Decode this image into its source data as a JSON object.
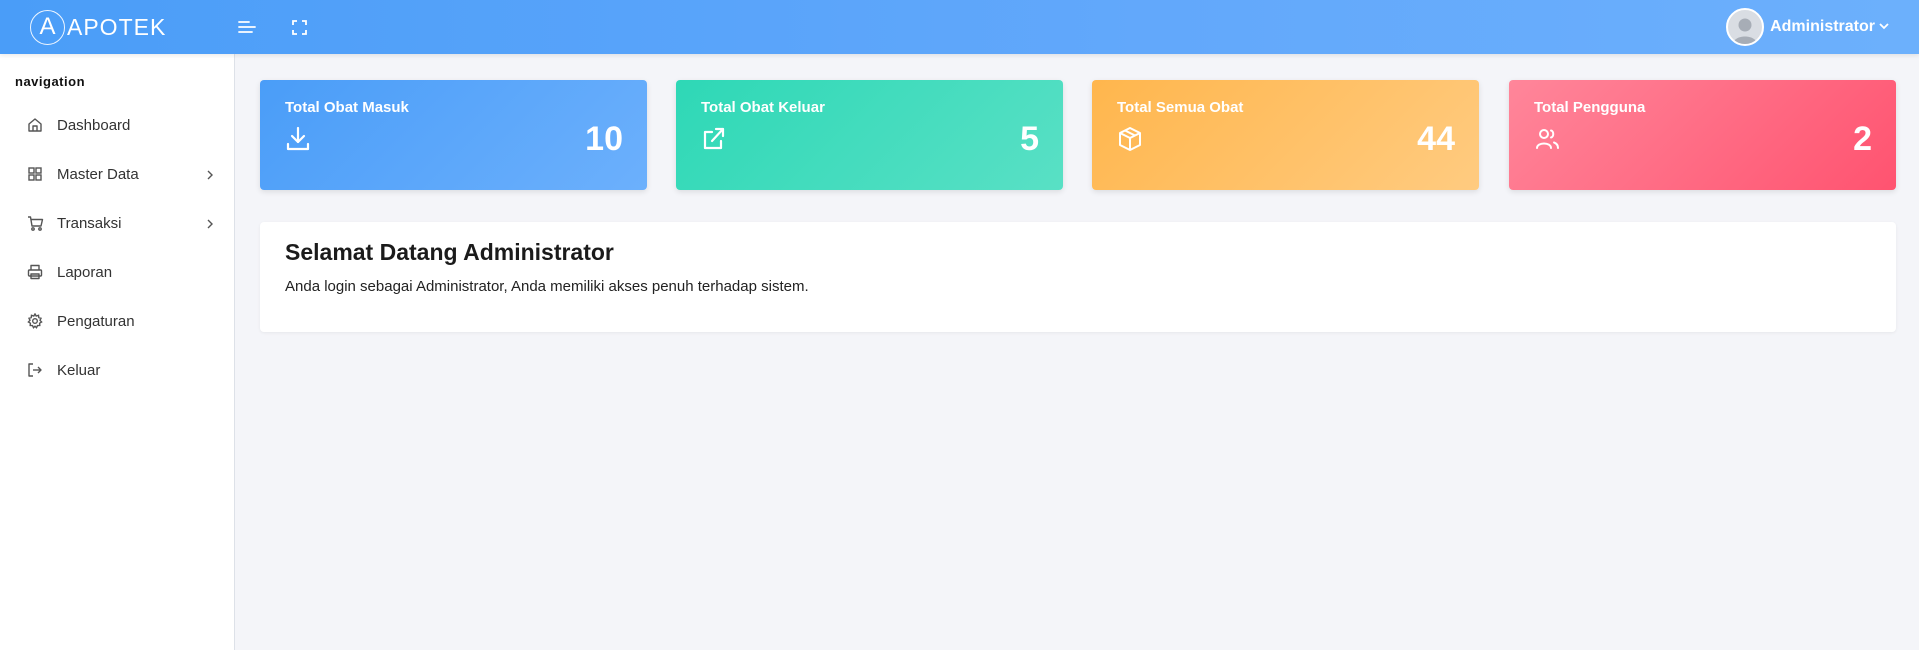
{
  "header": {
    "brand_letter": "A",
    "brand_name": "APOTEK",
    "user_name": "Administrator",
    "icons": {
      "menu_toggle": "menu-toggle-icon",
      "fullscreen": "fullscreen-icon",
      "user_menu": "chevron-down-icon"
    },
    "colors": {
      "gradient_start": "#4a9df8",
      "gradient_end": "#6cb0fc"
    }
  },
  "sidebar": {
    "title": "navigation",
    "items": [
      {
        "label": "Dashboard",
        "icon": "home-icon",
        "has_submenu": false
      },
      {
        "label": "Master Data",
        "icon": "grid-icon",
        "has_submenu": true
      },
      {
        "label": "Transaksi",
        "icon": "cart-icon",
        "has_submenu": true
      },
      {
        "label": "Laporan",
        "icon": "printer-icon",
        "has_submenu": false
      },
      {
        "label": "Pengaturan",
        "icon": "gear-icon",
        "has_submenu": false
      },
      {
        "label": "Keluar",
        "icon": "logout-icon",
        "has_submenu": false
      }
    ]
  },
  "stats": [
    {
      "title": "Total Obat Masuk",
      "value": "10",
      "icon": "download-icon",
      "color_start": "#4a9df8",
      "color_end": "#6cb0fc"
    },
    {
      "title": "Total Obat Keluar",
      "value": "5",
      "icon": "external-link-icon",
      "color_start": "#2ed8b6",
      "color_end": "#59e0c5"
    },
    {
      "title": "Total Semua Obat",
      "value": "44",
      "icon": "box-icon",
      "color_start": "#ffb64d",
      "color_end": "#ffcb80"
    },
    {
      "title": "Total Pengguna",
      "value": "2",
      "icon": "users-icon",
      "color_start": "#ff5370",
      "color_end": "#ff869a"
    }
  ],
  "welcome": {
    "title": "Selamat Datang Administrator",
    "text": "Anda login sebagai Administrator, Anda memiliki akses penuh terhadap sistem."
  }
}
